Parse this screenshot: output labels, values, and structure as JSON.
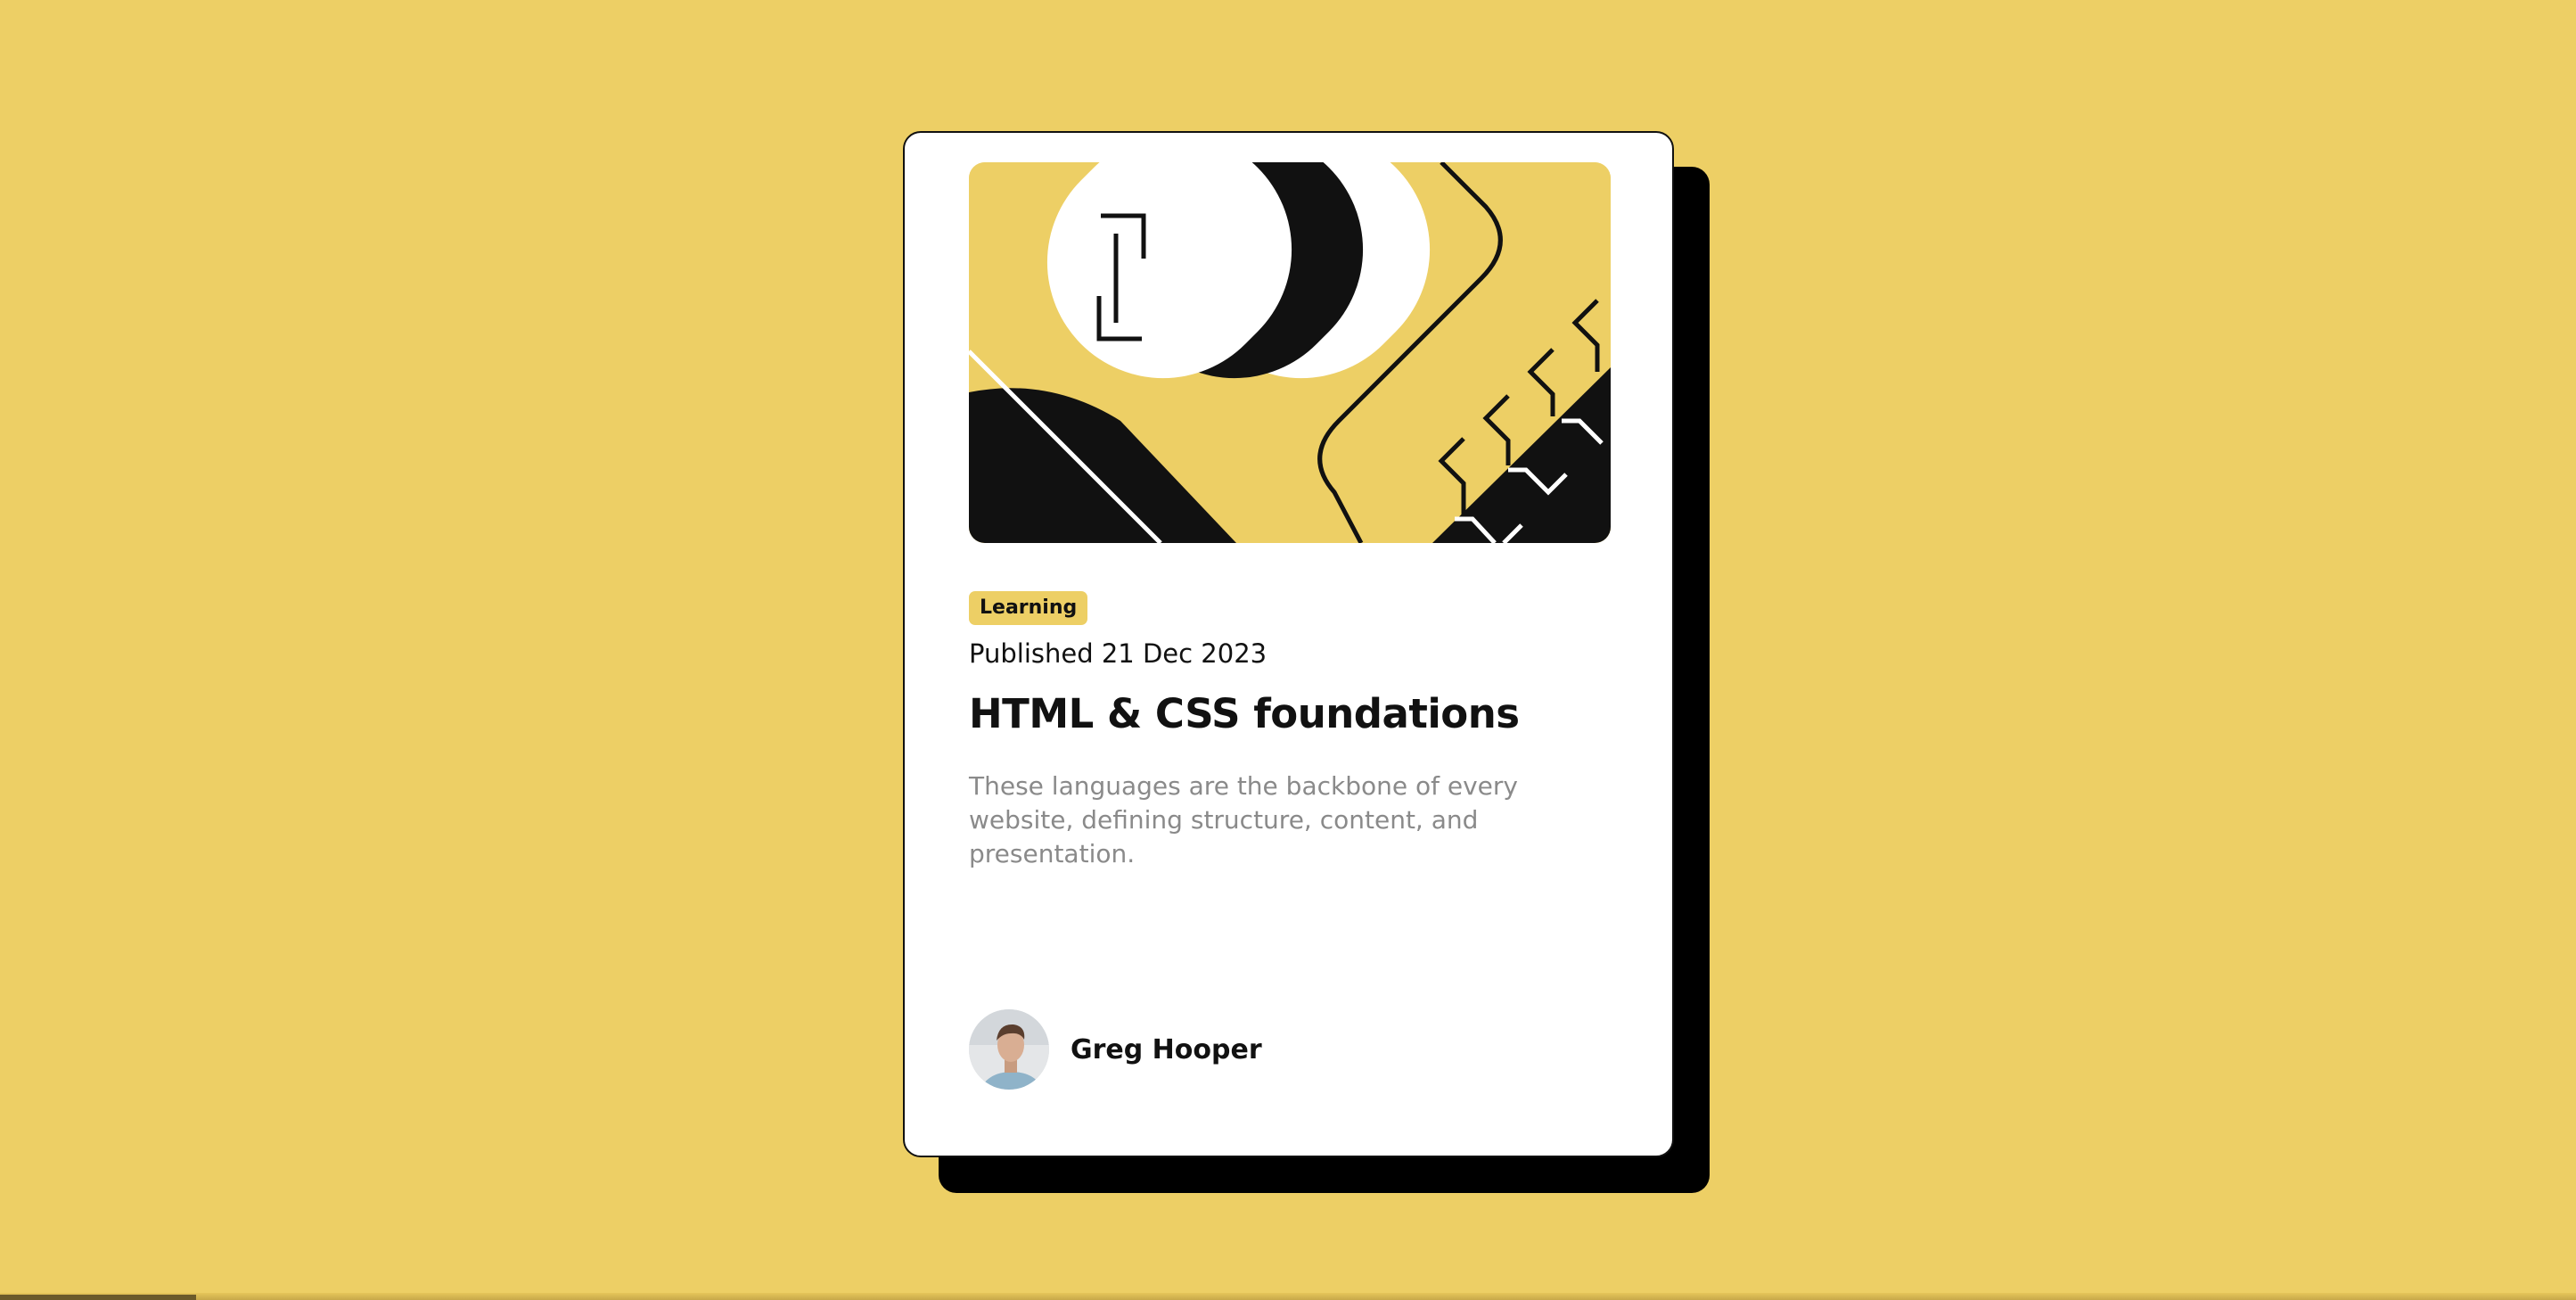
{
  "page": {
    "background_color": "#EDCF65"
  },
  "card": {
    "hero_image": "illustration-article",
    "category_tag": "Learning",
    "published": "Published 21 Dec 2023",
    "title": "HTML & CSS foundations",
    "description": "These languages are the backbone of every website, defining structure, content, and presentation.",
    "author": {
      "name": "Greg Hooper",
      "avatar": "author-avatar"
    }
  }
}
